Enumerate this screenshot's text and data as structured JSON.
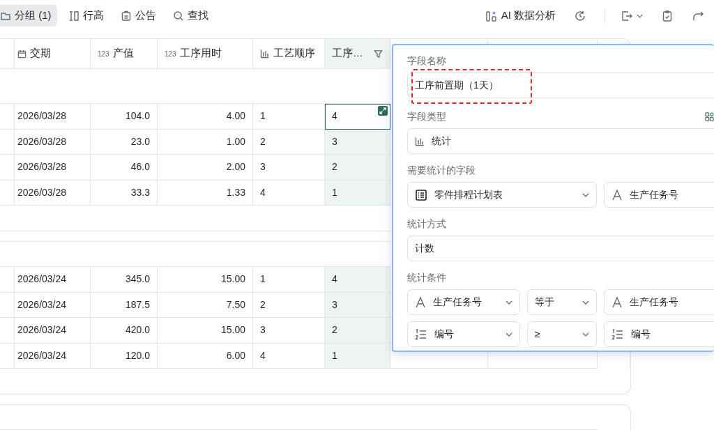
{
  "toolbar": {
    "left": [
      {
        "kind": "group",
        "label": "分组 (1)",
        "selected": true
      },
      {
        "kind": "rowheight",
        "label": "行高",
        "selected": false
      },
      {
        "kind": "notice",
        "label": "公告",
        "selected": false
      },
      {
        "kind": "search",
        "label": "查找",
        "selected": false
      }
    ],
    "right": [
      {
        "kind": "ai",
        "label": "AI 数据分析"
      },
      {
        "kind": "history"
      },
      {
        "kind": "export",
        "caret": true
      },
      {
        "kind": "clipboard"
      },
      {
        "kind": "share"
      }
    ]
  },
  "table": {
    "columns": [
      {
        "kind": "date",
        "label": "交期"
      },
      {
        "kind": "number",
        "type_mark": "123",
        "label": "产值"
      },
      {
        "kind": "number",
        "type_mark": "123",
        "label": "工序用时"
      },
      {
        "kind": "stat",
        "label": "工艺顺序"
      },
      {
        "kind": "plain",
        "label": "工序…",
        "filter": true,
        "highlighted": true
      }
    ],
    "groups": [
      {
        "rows": [
          {
            "cells": [
              "2026/03/28",
              "104.0",
              "4.00",
              "1",
              "4"
            ],
            "selected": true
          },
          {
            "cells": [
              "2026/03/28",
              "23.0",
              "1.00",
              "2",
              "3"
            ],
            "selected": false
          },
          {
            "cells": [
              "2026/03/28",
              "46.0",
              "2.00",
              "3",
              "2"
            ],
            "selected": false
          },
          {
            "cells": [
              "2026/03/28",
              "33.3",
              "1.33",
              "4",
              "1"
            ],
            "selected": false
          }
        ]
      },
      {
        "rows": [
          {
            "cells": [
              "2026/03/24",
              "345.0",
              "15.00",
              "1",
              "4"
            ],
            "selected": false
          },
          {
            "cells": [
              "2026/03/24",
              "187.5",
              "7.50",
              "2",
              "3"
            ],
            "selected": false
          },
          {
            "cells": [
              "2026/03/24",
              "420.0",
              "15.00",
              "3",
              "2"
            ],
            "selected": false
          },
          {
            "cells": [
              "2026/03/24",
              "120.0",
              "6.00",
              "4",
              "1"
            ],
            "selected": false
          }
        ]
      }
    ]
  },
  "panel": {
    "name_label": "字段名称",
    "name_value": "工序前置期（1天）",
    "name_highlighted": true,
    "type_label": "字段类型",
    "type_value": "统计",
    "source_label": "需要统计的字段",
    "source": [
      {
        "kind": "table",
        "label": "零件排程计划表",
        "caret": true
      },
      {
        "kind": "text",
        "label": "生产任务号",
        "caret": false
      }
    ],
    "method_label": "统计方式",
    "method_value": "计数",
    "condition_label": "统计条件",
    "conditions": [
      [
        {
          "kind": "text",
          "label": "生产任务号",
          "caret": true
        },
        {
          "kind": "plain",
          "label": "等于",
          "caret": true
        },
        {
          "kind": "text",
          "label": "生产任务号",
          "caret": false
        }
      ],
      [
        {
          "kind": "ordered",
          "label": "编号",
          "caret": true
        },
        {
          "kind": "plain",
          "label": "≥",
          "caret": true
        },
        {
          "kind": "ordered",
          "label": "编号",
          "caret": false
        }
      ]
    ]
  }
}
